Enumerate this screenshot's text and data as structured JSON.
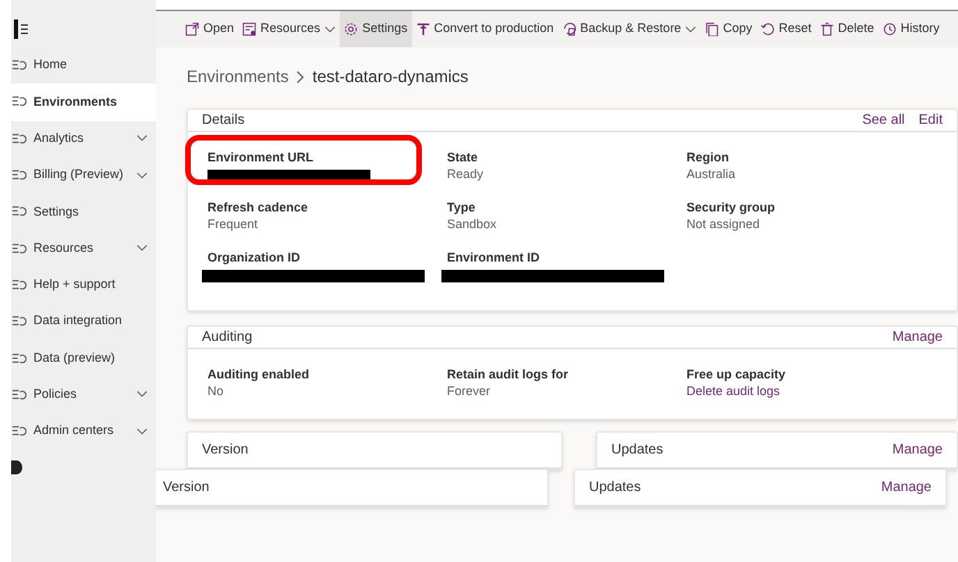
{
  "toolbar": [
    {
      "label": "Open",
      "dropdown": false,
      "selected": false
    },
    {
      "label": "Resources",
      "dropdown": true,
      "selected": false
    },
    {
      "label": "Settings",
      "dropdown": false,
      "selected": true
    },
    {
      "label": "Convert to production",
      "dropdown": false,
      "selected": false
    },
    {
      "label": "Backup & Restore",
      "dropdown": true,
      "selected": false
    },
    {
      "label": "Copy",
      "dropdown": false,
      "selected": false
    },
    {
      "label": "Reset",
      "dropdown": false,
      "selected": false
    },
    {
      "label": "Delete",
      "dropdown": false,
      "selected": false
    },
    {
      "label": "History",
      "dropdown": false,
      "selected": false
    }
  ],
  "sidebar": {
    "items": [
      {
        "label": "Home",
        "selected": false,
        "dropdown": false
      },
      {
        "label": "Environments",
        "selected": true,
        "dropdown": false
      },
      {
        "label": "Analytics",
        "selected": false,
        "dropdown": true
      },
      {
        "label": "Billing (Preview)",
        "selected": false,
        "dropdown": true
      },
      {
        "label": "Settings",
        "selected": false,
        "dropdown": false
      },
      {
        "label": "Resources",
        "selected": false,
        "dropdown": true
      },
      {
        "label": "Help + support",
        "selected": false,
        "dropdown": false
      },
      {
        "label": "Data integration",
        "selected": false,
        "dropdown": false
      },
      {
        "label": "Data (preview)",
        "selected": false,
        "dropdown": false
      },
      {
        "label": "Policies",
        "selected": false,
        "dropdown": true
      },
      {
        "label": "Admin centers",
        "selected": false,
        "dropdown": true
      }
    ]
  },
  "breadcrumb": [
    "Environments",
    "test-dataro-dynamics"
  ],
  "details": {
    "title": "Details",
    "actions": [
      "See all",
      "Edit"
    ],
    "fields": [
      {
        "label": "Environment URL",
        "kind": "redacted",
        "highlighted": true
      },
      {
        "label": "State",
        "value": "Ready",
        "kind": "text",
        "highlighted": false
      },
      {
        "label": "Region",
        "value": "Australia",
        "kind": "text",
        "highlighted": false
      },
      {
        "label": "Refresh cadence",
        "value": "Frequent",
        "kind": "text",
        "highlighted": false
      },
      {
        "label": "Type",
        "value": "Sandbox",
        "kind": "text",
        "highlighted": false
      },
      {
        "label": "Security group",
        "value": "Not assigned",
        "kind": "text",
        "highlighted": false
      },
      {
        "label": "Organization ID",
        "kind": "redacted",
        "highlighted": false
      },
      {
        "label": "Environment ID",
        "kind": "redacted",
        "highlighted": false
      }
    ]
  },
  "auditing": {
    "title": "Auditing",
    "actions": [
      "Manage"
    ],
    "fields": [
      {
        "label": "Auditing enabled",
        "value": "No",
        "kind": "text",
        "highlighted": false
      },
      {
        "label": "Retain audit logs for",
        "value": "Forever",
        "kind": "text",
        "highlighted": false
      },
      {
        "label": "Free up capacity",
        "value": "Delete audit logs",
        "kind": "link",
        "highlighted": false
      }
    ]
  },
  "lower_cards": [
    {
      "title": "Version"
    },
    {
      "title": "Updates",
      "actions": [
        "Manage"
      ]
    }
  ],
  "lower_cards_repeat": [
    {
      "title": "Version"
    },
    {
      "title": "Updates",
      "actions": [
        "Manage"
      ]
    }
  ]
}
